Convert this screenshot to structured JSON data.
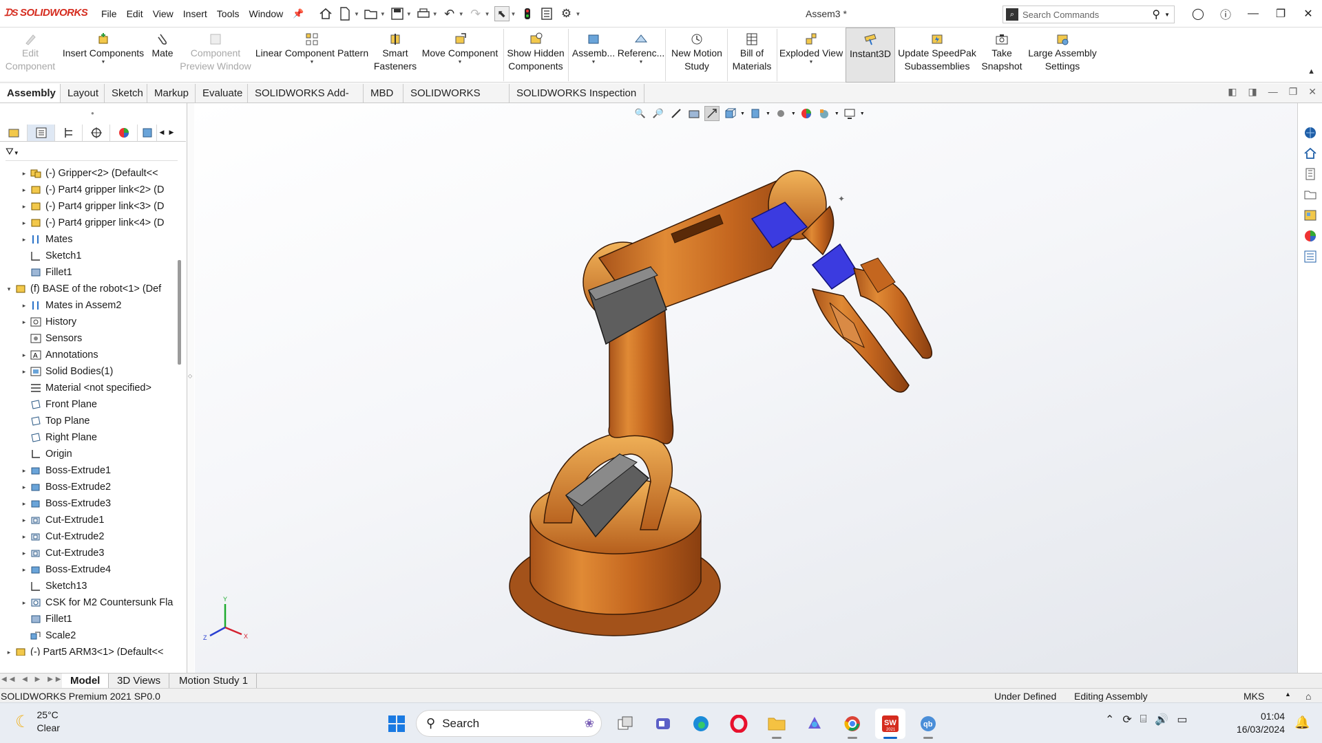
{
  "app": {
    "logo_text": "SOLIDWORKS",
    "document_title": "Assem3 *"
  },
  "menu": [
    "File",
    "Edit",
    "View",
    "Insert",
    "Tools",
    "Window"
  ],
  "search": {
    "placeholder": "Search Commands"
  },
  "ribbon": [
    {
      "label1": "Edit",
      "label2": "Component",
      "disabled": true
    },
    {
      "label1": "Insert Components",
      "label2": ""
    },
    {
      "label1": "Mate",
      "label2": ""
    },
    {
      "label1": "Component",
      "label2": "Preview Window",
      "disabled": true
    },
    {
      "label1": "Linear Component Pattern",
      "label2": ""
    },
    {
      "label1": "Smart",
      "label2": "Fasteners"
    },
    {
      "label1": "Move Component",
      "label2": ""
    },
    {
      "label1": "Show Hidden",
      "label2": "Components"
    },
    {
      "label1": "Assemb...",
      "label2": ""
    },
    {
      "label1": "Referenc...",
      "label2": ""
    },
    {
      "label1": "New Motion",
      "label2": "Study"
    },
    {
      "label1": "Bill of",
      "label2": "Materials"
    },
    {
      "label1": "Exploded View",
      "label2": ""
    },
    {
      "label1": "Instant3D",
      "label2": "",
      "active": true
    },
    {
      "label1": "Update SpeedPak",
      "label2": "Subassemblies"
    },
    {
      "label1": "Take",
      "label2": "Snapshot"
    },
    {
      "label1": "Large Assembly",
      "label2": "Settings"
    }
  ],
  "tabs": [
    "Assembly",
    "Layout",
    "Sketch",
    "Markup",
    "Evaluate",
    "SOLIDWORKS Add-Ins",
    "MBD",
    "SOLIDWORKS CAM",
    "SOLIDWORKS Inspection"
  ],
  "active_tab": "Assembly",
  "tree": [
    {
      "label": "(-) Gripper<2> (Default<<",
      "indent": 1,
      "exp": "▸",
      "icon": "assembly-icon"
    },
    {
      "label": "(-) Part4 gripper link<2> (D",
      "indent": 1,
      "exp": "▸",
      "icon": "part-icon"
    },
    {
      "label": "(-) Part4 gripper link<3> (D",
      "indent": 1,
      "exp": "▸",
      "icon": "part-icon"
    },
    {
      "label": "(-) Part4 gripper link<4> (D",
      "indent": 1,
      "exp": "▸",
      "icon": "part-icon"
    },
    {
      "label": "Mates",
      "indent": 1,
      "exp": "▸",
      "icon": "mates-icon"
    },
    {
      "label": "Sketch1",
      "indent": 1,
      "exp": "",
      "icon": "sketch-icon"
    },
    {
      "label": "Fillet1",
      "indent": 1,
      "exp": "",
      "icon": "fillet-icon"
    },
    {
      "label": "(f) BASE of the robot<1> (Def",
      "indent": 0,
      "exp": "▾",
      "icon": "part-icon"
    },
    {
      "label": "Mates in Assem2",
      "indent": 1,
      "exp": "▸",
      "icon": "mates-icon"
    },
    {
      "label": "History",
      "indent": 1,
      "exp": "▸",
      "icon": "history-icon"
    },
    {
      "label": "Sensors",
      "indent": 1,
      "exp": "",
      "icon": "sensor-icon"
    },
    {
      "label": "Annotations",
      "indent": 1,
      "exp": "▸",
      "icon": "annotation-icon"
    },
    {
      "label": "Solid Bodies(1)",
      "indent": 1,
      "exp": "▸",
      "icon": "solid-body-icon"
    },
    {
      "label": "Material <not specified>",
      "indent": 1,
      "exp": "",
      "icon": "material-icon"
    },
    {
      "label": "Front Plane",
      "indent": 1,
      "exp": "",
      "icon": "plane-icon"
    },
    {
      "label": "Top Plane",
      "indent": 1,
      "exp": "",
      "icon": "plane-icon"
    },
    {
      "label": "Right Plane",
      "indent": 1,
      "exp": "",
      "icon": "plane-icon"
    },
    {
      "label": "Origin",
      "indent": 1,
      "exp": "",
      "icon": "origin-icon"
    },
    {
      "label": "Boss-Extrude1",
      "indent": 1,
      "exp": "▸",
      "icon": "extrude-icon"
    },
    {
      "label": "Boss-Extrude2",
      "indent": 1,
      "exp": "▸",
      "icon": "extrude-icon"
    },
    {
      "label": "Boss-Extrude3",
      "indent": 1,
      "exp": "▸",
      "icon": "extrude-icon"
    },
    {
      "label": "Cut-Extrude1",
      "indent": 1,
      "exp": "▸",
      "icon": "cut-icon"
    },
    {
      "label": "Cut-Extrude2",
      "indent": 1,
      "exp": "▸",
      "icon": "cut-icon"
    },
    {
      "label": "Cut-Extrude3",
      "indent": 1,
      "exp": "▸",
      "icon": "cut-icon"
    },
    {
      "label": "Boss-Extrude4",
      "indent": 1,
      "exp": "▸",
      "icon": "extrude-icon"
    },
    {
      "label": "Sketch13",
      "indent": 1,
      "exp": "",
      "icon": "sketch-icon"
    },
    {
      "label": "CSK for M2 Countersunk Fla",
      "indent": 1,
      "exp": "▸",
      "icon": "hole-icon"
    },
    {
      "label": "Fillet1",
      "indent": 1,
      "exp": "",
      "icon": "fillet-icon"
    },
    {
      "label": "Scale2",
      "indent": 1,
      "exp": "",
      "icon": "scale-icon"
    },
    {
      "label": "(-) Part5 ARM3<1> (Default<<",
      "indent": 0,
      "exp": "▸",
      "icon": "part-icon"
    }
  ],
  "triad": {
    "x": "X",
    "y": "Y",
    "z": "Z"
  },
  "bottom_tabs": [
    "Model",
    "3D Views",
    "Motion Study 1"
  ],
  "status": {
    "left": "SOLIDWORKS Premium 2021 SP0.0",
    "definition": "Under Defined",
    "mode": "Editing Assembly",
    "units": "MKS"
  },
  "taskbar": {
    "weather_temp": "25°C",
    "weather_desc": "Clear",
    "search_label": "Search",
    "time": "01:04",
    "date": "16/03/2024",
    "sw_badge": "2021"
  }
}
